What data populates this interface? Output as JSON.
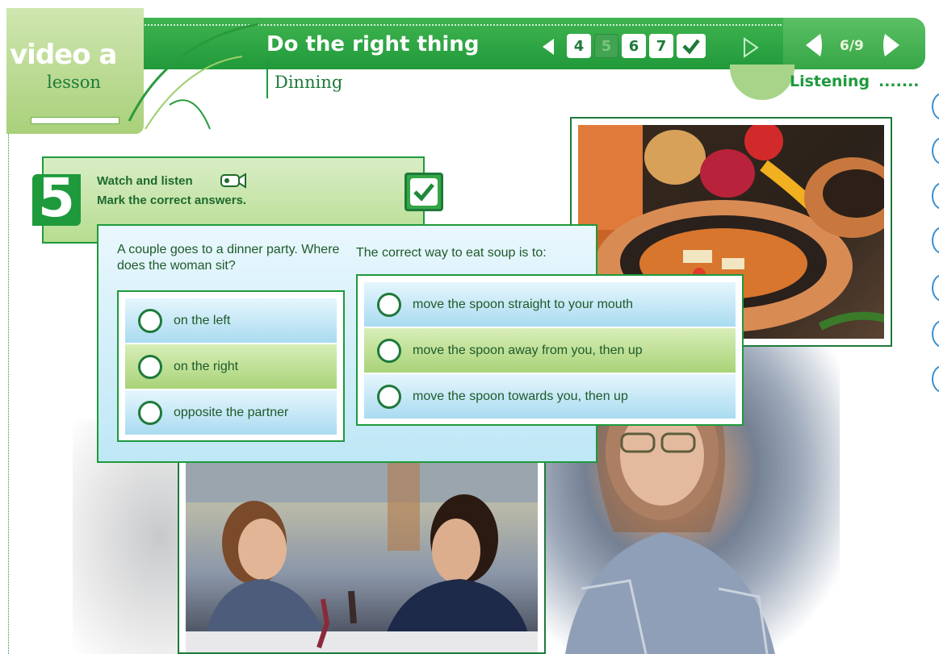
{
  "header": {
    "logo_word": "video a",
    "logo_sub": "lesson",
    "title": "Do the right thing",
    "subtitle": "Dinning",
    "steps": [
      "4",
      "5",
      "6",
      "7"
    ],
    "page_counter": "6/9",
    "section": "Listening",
    "section_dots": "......."
  },
  "exercise": {
    "number": "5",
    "instruction_line1": "Watch and listen",
    "instruction_period": ".",
    "instruction_line2": "Mark the correct answers.",
    "question1": {
      "text": "A couple goes to a dinner party. Where does the woman sit?",
      "options": [
        "on the left",
        "on the right",
        "opposite the partner"
      ],
      "selected_index": 1
    },
    "question2": {
      "text": "The correct way to eat soup is to:",
      "options": [
        "move the spoon straight to your mouth",
        "move the spoon away from you, then up",
        "move the spoon towards you, then up"
      ],
      "selected_index": 1
    }
  },
  "colors": {
    "brand_green": "#219a3b",
    "light_green": "#a8d378",
    "option_blue": "#a9dbf0"
  },
  "icons": [
    "video-camera-icon",
    "check-icon",
    "arrow-left-icon",
    "arrow-right-icon"
  ]
}
